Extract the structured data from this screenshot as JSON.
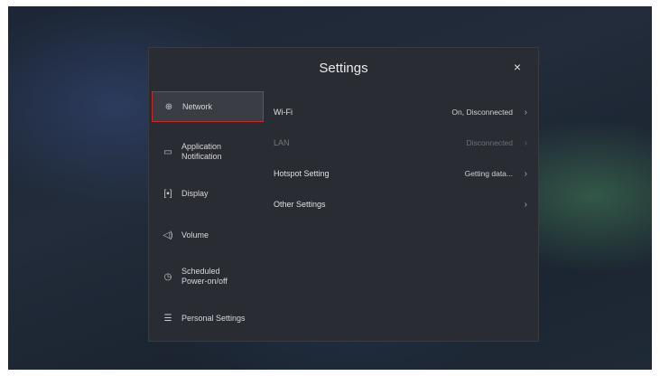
{
  "settings": {
    "title": "Settings",
    "close_icon": "×",
    "sidebar": [
      {
        "label": "Network",
        "icon": "globe-icon",
        "glyph": "⊕",
        "active": true
      },
      {
        "label": "Application\nNotification",
        "icon": "notification-icon",
        "glyph": "▭",
        "active": false
      },
      {
        "label": "Display",
        "icon": "display-icon",
        "glyph": "[▪]",
        "active": false
      },
      {
        "label": "Volume",
        "icon": "speaker-icon",
        "glyph": "◁)",
        "active": false
      },
      {
        "label": "Scheduled\nPower-on/off",
        "icon": "clock-icon",
        "glyph": "◷",
        "active": false
      },
      {
        "label": "Personal Settings",
        "icon": "menu-icon",
        "glyph": "☰",
        "active": false
      }
    ],
    "rows": [
      {
        "label": "Wi-Fi",
        "value": "On, Disconnected",
        "chevron": "›",
        "enabled": true
      },
      {
        "label": "LAN",
        "value": "Disconnected",
        "chevron": "›",
        "enabled": false
      },
      {
        "label": "Hotspot Setting",
        "value": "Getting data...",
        "chevron": "›",
        "enabled": true
      },
      {
        "label": "Other Settings",
        "value": "",
        "chevron": "›",
        "enabled": true
      }
    ]
  },
  "colors": {
    "panel_bg": "#2a2c33",
    "active_border": "#c62b2b",
    "text": "#dfe0e5"
  }
}
